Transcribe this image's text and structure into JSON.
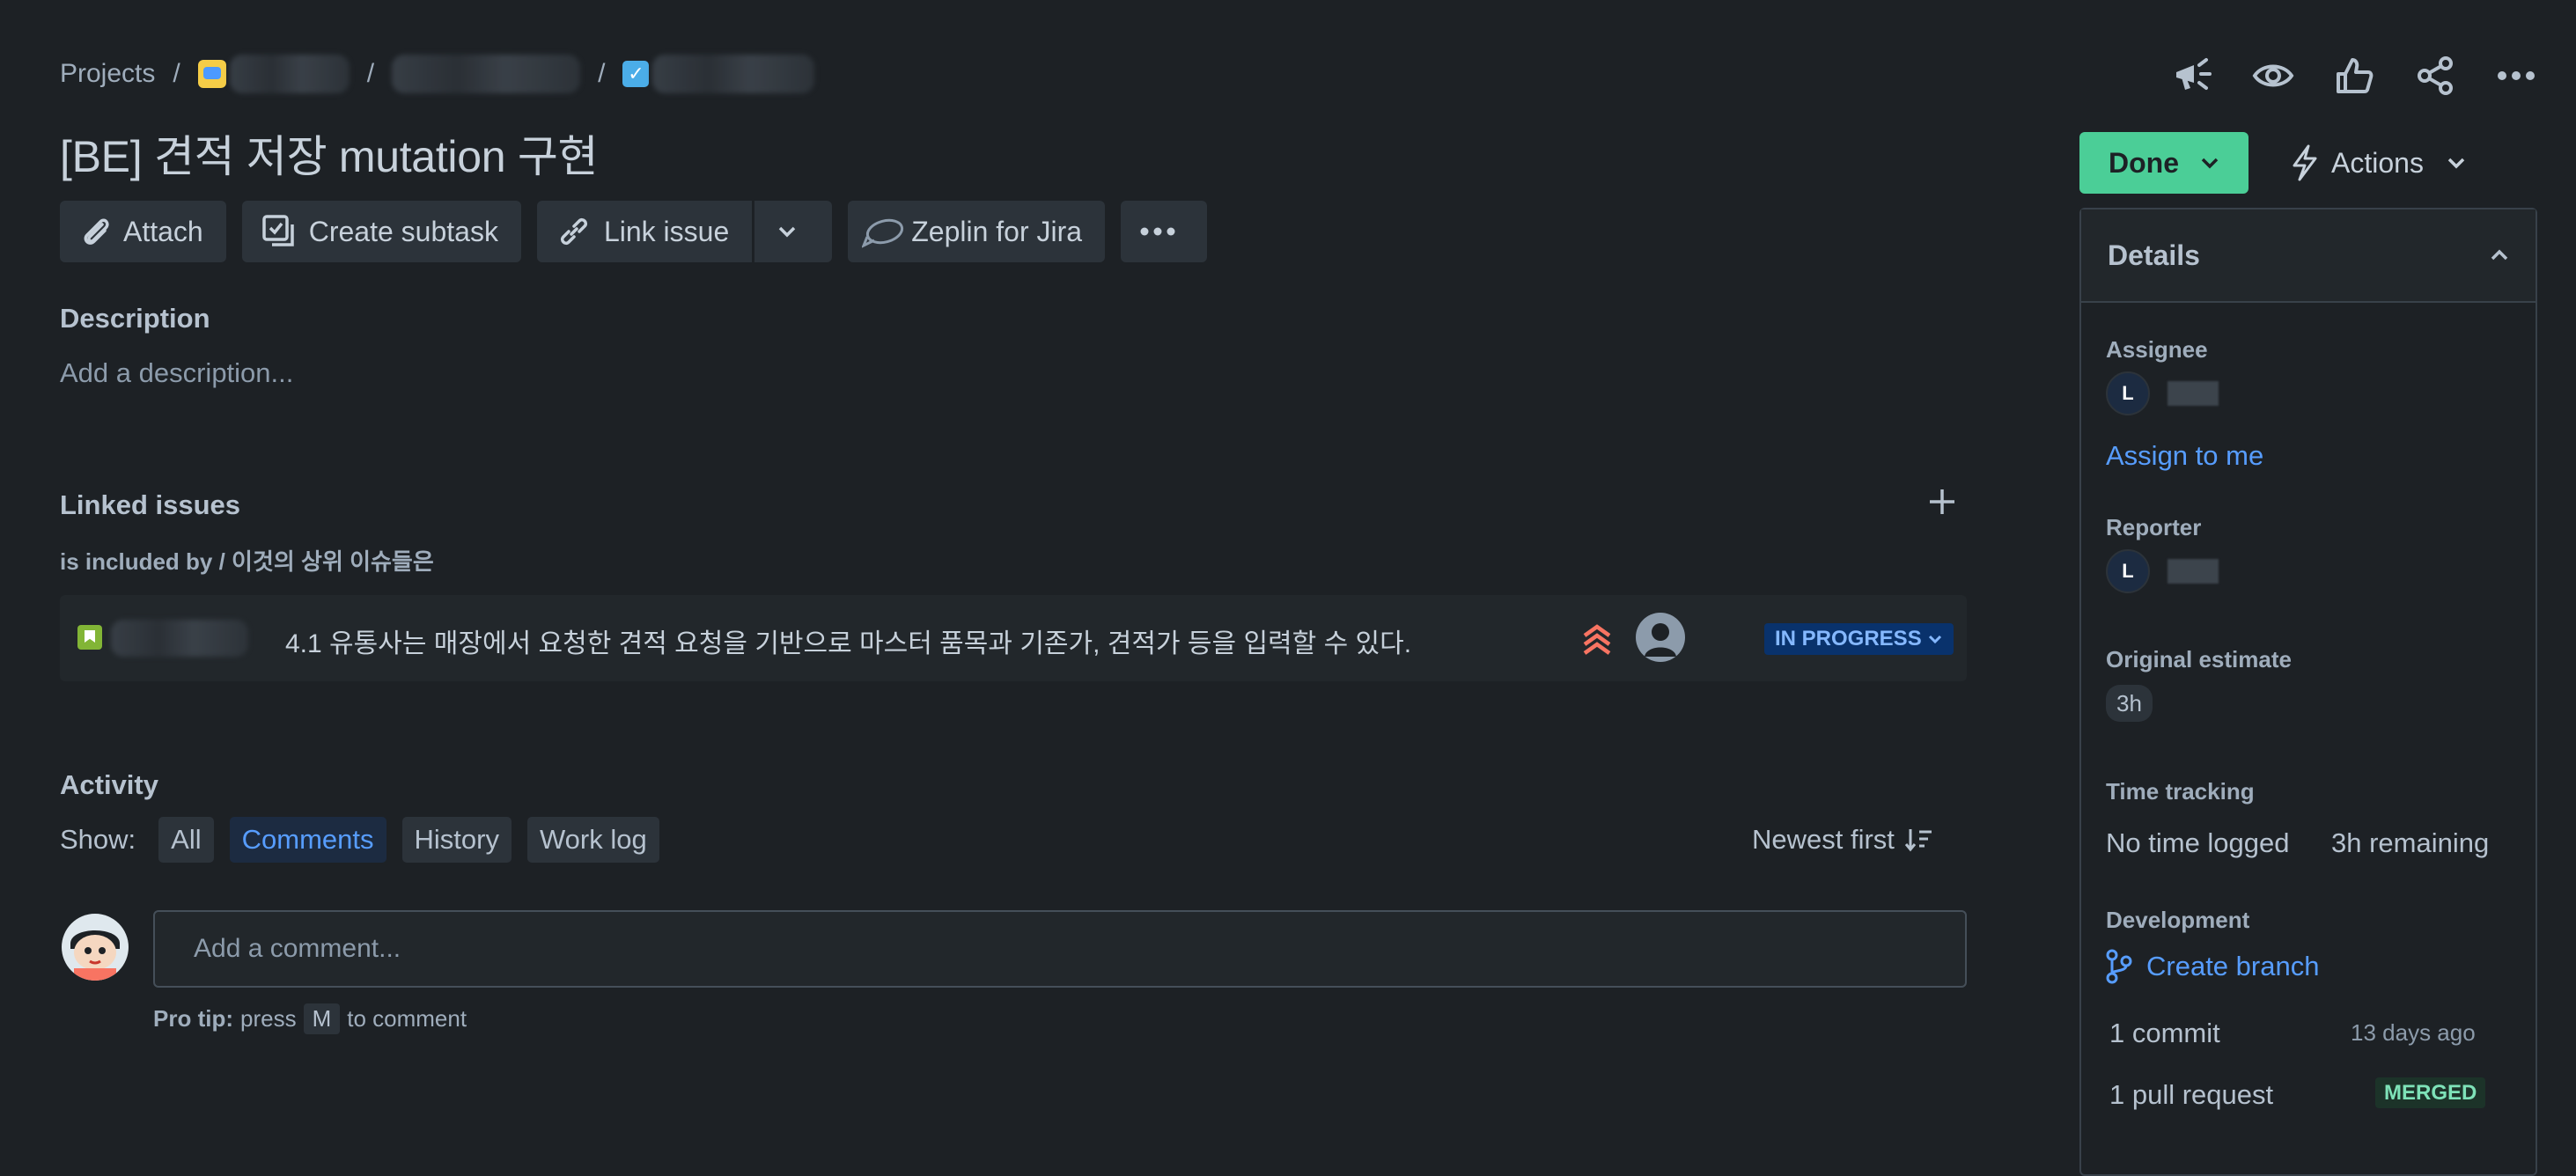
{
  "breadcrumb": {
    "root": "Projects",
    "separator": "/"
  },
  "issue": {
    "title": "[BE] 견적 저장 mutation 구현"
  },
  "toolbar": {
    "attach": "Attach",
    "create_subtask": "Create subtask",
    "link_issue": "Link issue",
    "zeplin": "Zeplin for Jira"
  },
  "description": {
    "heading": "Description",
    "placeholder": "Add a description..."
  },
  "linked_issues": {
    "heading": "Linked issues",
    "relation": "is included by / 이것의 상위 이슈들은",
    "items": [
      {
        "summary": "4.1 유통사는 매장에서 요청한 견적 요청을 기반으로 마스터 품목과 기존가, 견적가 등을 입력할 수 있다.",
        "status": "IN PROGRESS",
        "priority_icon": "highest-priority-icon"
      }
    ]
  },
  "activity": {
    "heading": "Activity",
    "show_label": "Show:",
    "filters": [
      "All",
      "Comments",
      "History",
      "Work log"
    ],
    "active_filter": "Comments",
    "sort": "Newest first",
    "comment_placeholder": "Add a comment...",
    "pro_tip_label": "Pro tip:",
    "pro_tip_pre": "press",
    "pro_tip_key": "M",
    "pro_tip_post": "to comment"
  },
  "status_button": {
    "label": "Done"
  },
  "actions_button": {
    "label": "Actions"
  },
  "details": {
    "heading": "Details",
    "assignee_label": "Assignee",
    "assignee_initial": "L",
    "assign_to_me": "Assign to me",
    "reporter_label": "Reporter",
    "reporter_initial": "L",
    "original_estimate_label": "Original estimate",
    "original_estimate": "3h",
    "time_tracking_label": "Time tracking",
    "time_logged": "No time logged",
    "time_remaining": "3h remaining",
    "development_label": "Development",
    "create_branch": "Create branch",
    "commits": "1 commit",
    "commit_time": "13 days ago",
    "pull_requests": "1 pull request",
    "pr_status": "MERGED"
  },
  "colors": {
    "background": "#1d2125",
    "done": "#4bce97",
    "link": "#579dff",
    "in_progress_bg": "#09326c",
    "priority": "#f87462"
  }
}
